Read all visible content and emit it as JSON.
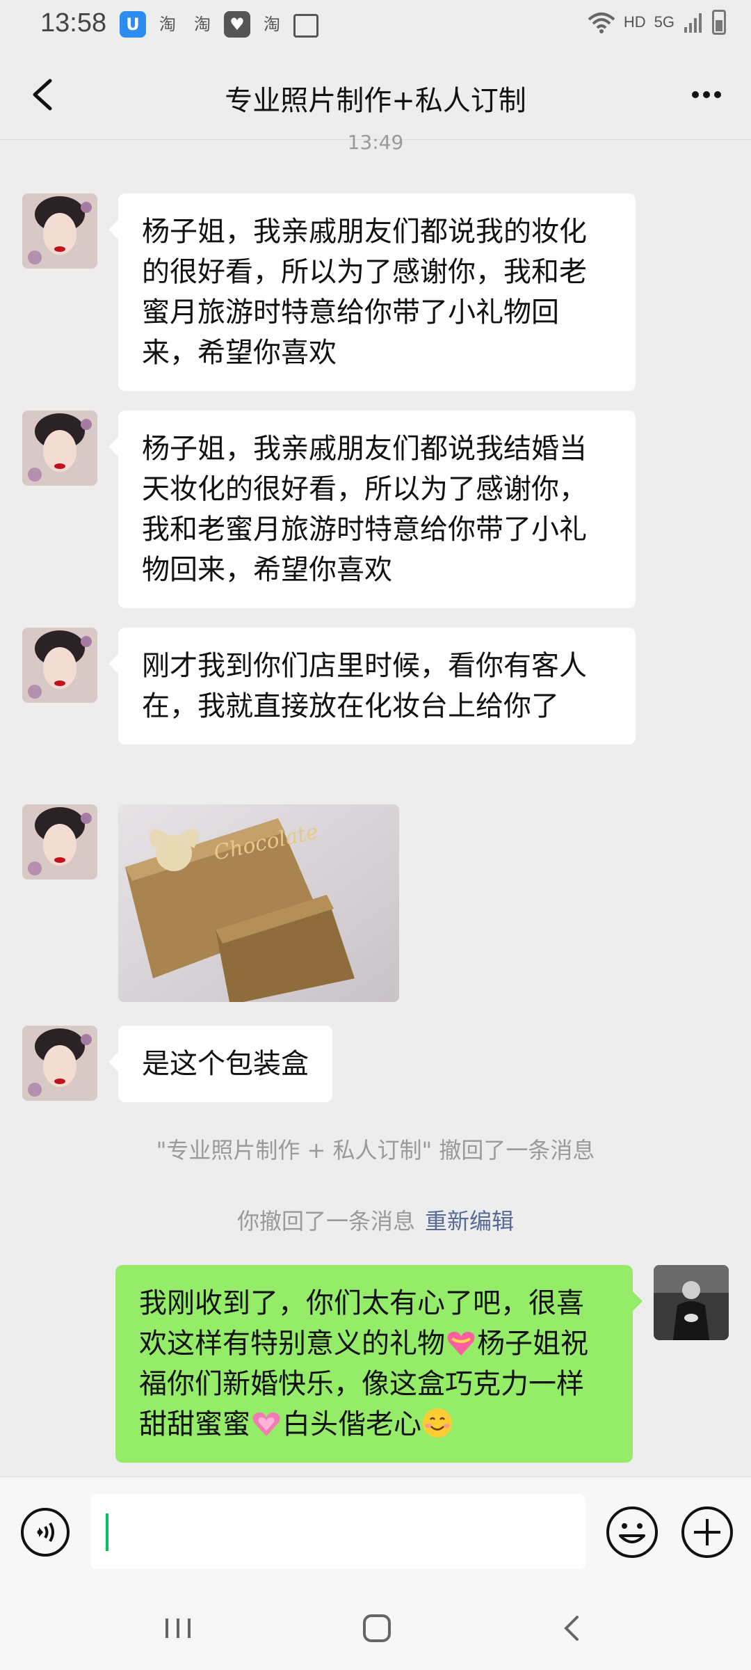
{
  "status_bar": {
    "time": "13:58",
    "apps": [
      "淘",
      "淘",
      "淘"
    ],
    "network_hd": "HD",
    "network_5g": "5G"
  },
  "header": {
    "title": "专业照片制作+私人订制"
  },
  "timestamp": "13:49",
  "messages": [
    {
      "text": "杨子姐，我亲戚朋友们都说我的妆化的很好看，所以为了感谢你，我和老蜜月旅游时特意给你带了小礼物回来，希望你喜欢"
    },
    {
      "text": "杨子姐，我亲戚朋友们都说我结婚当天妆化的很好看，所以为了感谢你，我和老蜜月旅游时特意给你带了小礼物回来，希望你喜欢"
    },
    {
      "text": "刚才我到你们店里时候，看你有客人在，我就直接放在化妆台上给你了"
    },
    {
      "photo_text": "Chocolate"
    },
    {
      "text": "是这个包装盒"
    }
  ],
  "system_notes": {
    "recall_other": "\"专业照片制作 + 私人订制\" 撤回了一条消息",
    "recall_self": "你撤回了一条消息",
    "reedit": "重新编辑"
  },
  "outgoing": {
    "part1": "我刚收到了，你们太有心了吧，很喜欢这样有特别意义的礼物",
    "part2": "杨子姐祝福你们新婚快乐，像这盒巧克力一样甜甜蜜蜜",
    "part3": "白头偕老心"
  },
  "input": {
    "value": ""
  },
  "colors": {
    "background": "#ededed",
    "outgoing_bubble": "#95ec69",
    "link": "#576b95",
    "caret": "#07c160"
  },
  "icons": [
    "back-arrow-icon",
    "more-dots-icon",
    "voice-icon",
    "emoji-icon",
    "plus-icon",
    "recent-apps-icon",
    "home-icon",
    "nav-back-icon"
  ]
}
